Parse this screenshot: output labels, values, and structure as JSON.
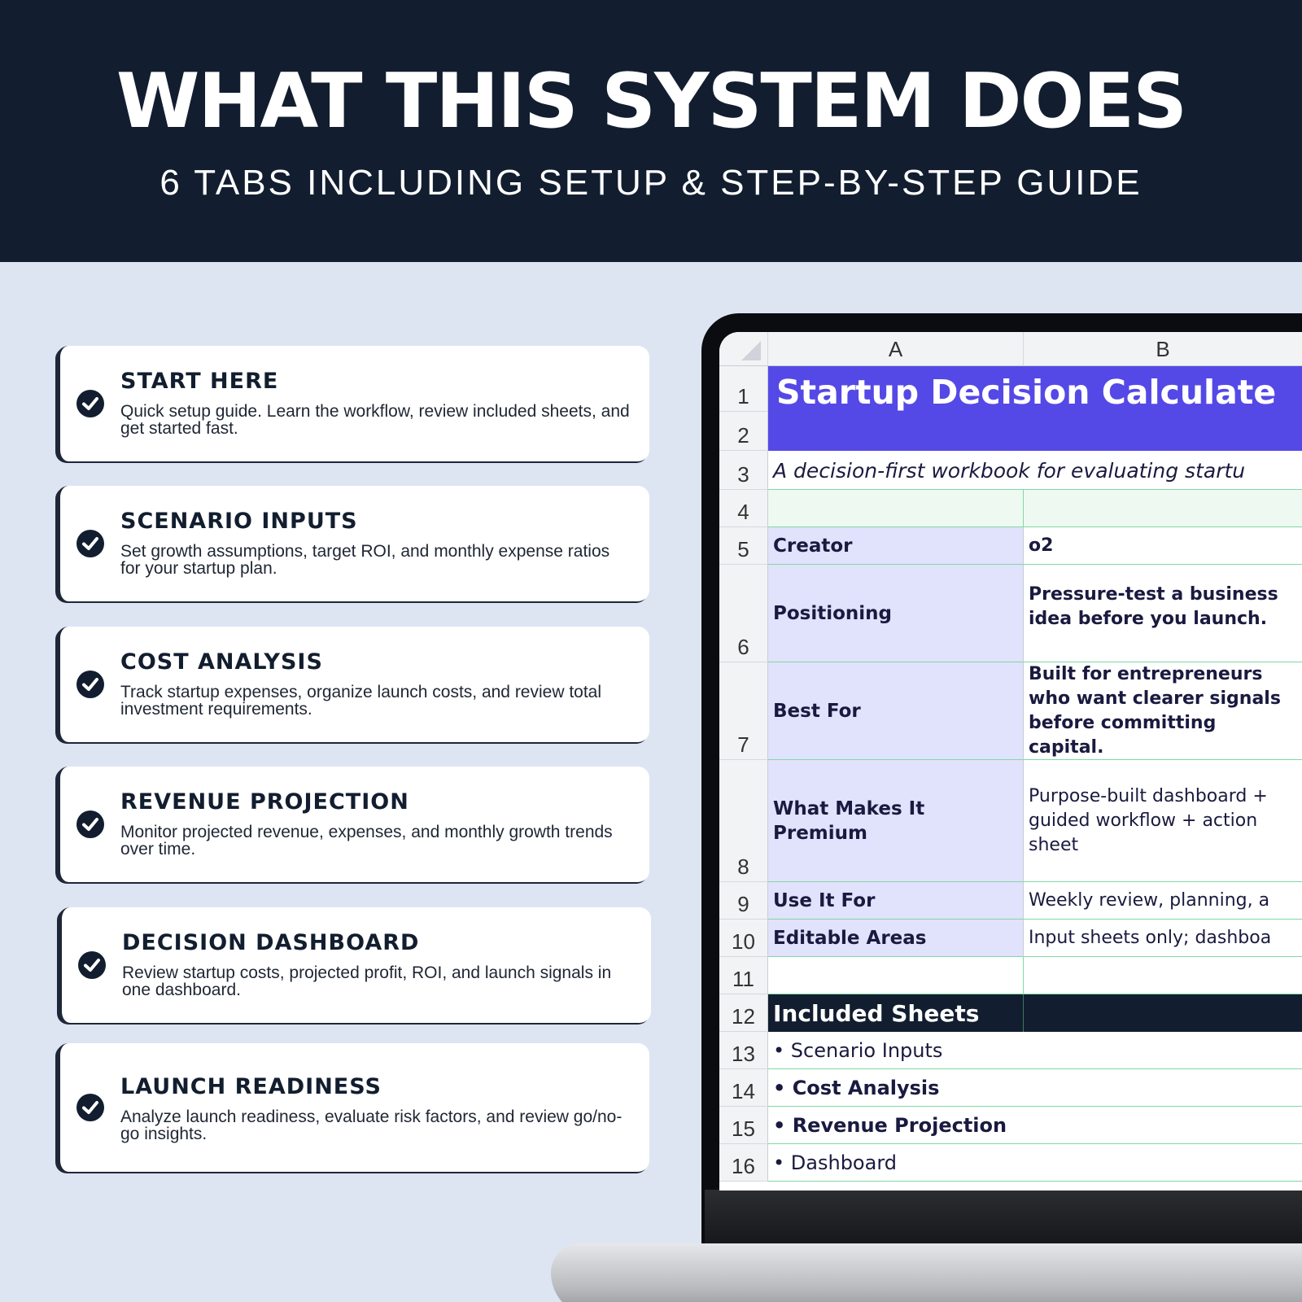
{
  "header": {
    "title": "WHAT THIS SYSTEM DOES",
    "subtitle": "6 TABS INCLUDING SETUP & STEP-BY-STEP GUIDE"
  },
  "features": [
    {
      "title": "START HERE",
      "description": "Quick setup guide. Learn the workflow, review included sheets, and get started fast."
    },
    {
      "title": "SCENARIO INPUTS",
      "description": "Set growth assumptions, target ROI, and monthly expense ratios for your startup plan."
    },
    {
      "title": "COST ANALYSIS",
      "description": "Track startup expenses, organize launch costs, and review total investment requirements."
    },
    {
      "title": "REVENUE PROJECTION",
      "description": "Monitor projected revenue, expenses, and monthly growth trends over time."
    },
    {
      "title": "DECISION DASHBOARD",
      "description": "Review startup costs, projected profit, ROI, and launch signals in one dashboard."
    },
    {
      "title": "LAUNCH READINESS",
      "description": "Analyze launch readiness, evaluate risk factors, and review go/no-go insights."
    }
  ],
  "spreadsheet": {
    "columns": [
      "A",
      "B"
    ],
    "rows": [
      "1",
      "2",
      "3",
      "4",
      "5",
      "6",
      "7",
      "8",
      "9",
      "10",
      "11",
      "12",
      "13",
      "14",
      "15",
      "16"
    ],
    "sheet_title": "Startup Decision Calculate",
    "subtitle": "A decision-first workbook for evaluating startu",
    "fields": [
      {
        "label": "Creator",
        "value": "o2"
      },
      {
        "label": "Positioning",
        "value": "Pressure-test a business idea before you launch."
      },
      {
        "label": "Best For",
        "value": "Built for entrepreneurs who want clearer signals before committing capital."
      },
      {
        "label": "What Makes It Premium",
        "value": "Purpose-built dashboard + guided workflow + action sheet"
      },
      {
        "label": "Use It For",
        "value": "Weekly review, planning, a"
      },
      {
        "label": "Editable Areas",
        "value": "Input sheets only; dashboa"
      }
    ],
    "included_title": "Included Sheets",
    "included": [
      "• Scenario Inputs",
      "• Cost Analysis",
      "• Revenue Projection",
      "• Dashboard"
    ],
    "title_bg": "#5449e6",
    "section_bg": "#121e2f"
  }
}
